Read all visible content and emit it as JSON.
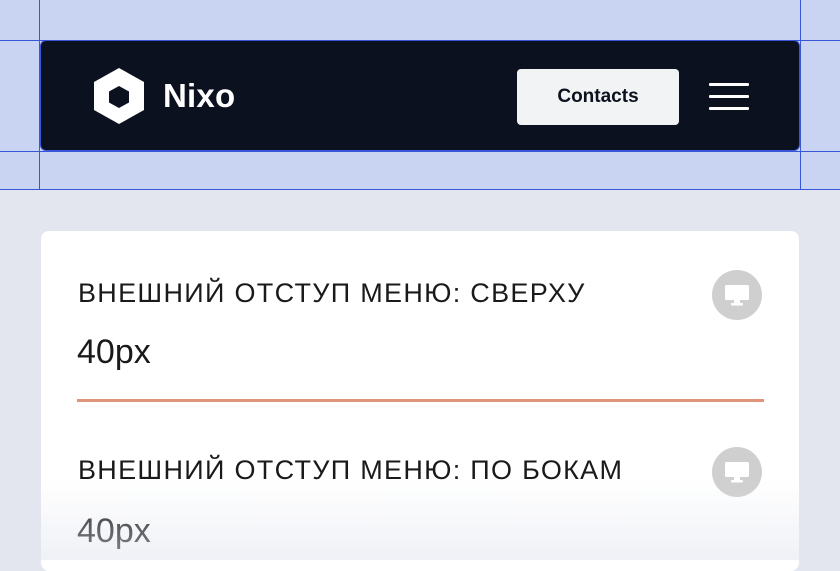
{
  "header": {
    "brand_name": "Nixo",
    "contacts_label": "Contacts",
    "logo_icon": "hexagon-logo-icon",
    "menu_icon": "hamburger-menu-icon"
  },
  "settings": {
    "fields": [
      {
        "label": "ВНЕШНИЙ ОТСТУП МЕНЮ: СВЕРХУ",
        "value": "40px",
        "device_icon": "desktop-monitor-icon"
      },
      {
        "label": "ВНЕШНИЙ ОТСТУП МЕНЮ: ПО БОКАМ",
        "value": "40px",
        "device_icon": "desktop-monitor-icon"
      }
    ]
  },
  "colors": {
    "navbar_bg": "#0c111f",
    "guide_overlay": "#c9d3f2",
    "guide_line": "#3a56d8",
    "active_underline": "#e0947a",
    "page_bg": "#e3e6ef"
  }
}
